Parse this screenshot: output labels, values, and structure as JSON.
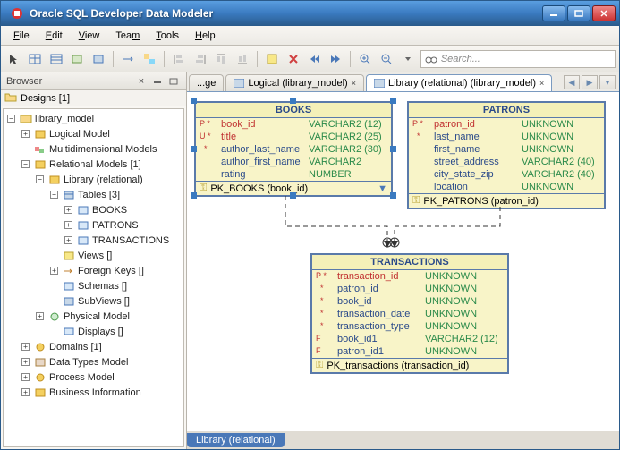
{
  "title": "Oracle SQL Developer Data Modeler",
  "menubar": {
    "file": "File",
    "edit": "Edit",
    "view": "View",
    "team": "Team",
    "tools": "Tools",
    "help": "Help"
  },
  "search_placeholder": "Search...",
  "browser": {
    "title": "Browser",
    "designs_label": "Designs [1]",
    "root": "library_model",
    "logical": "Logical Model",
    "multi": "Multidimensional Models",
    "relational": "Relational Models [1]",
    "library": "Library (relational)",
    "tables": "Tables [3]",
    "t1": "BOOKS",
    "t2": "PATRONS",
    "t3": "TRANSACTIONS",
    "views": "Views []",
    "fkeys": "Foreign Keys []",
    "schemas": "Schemas []",
    "subviews": "SubViews []",
    "physical": "Physical Model",
    "displays": "Displays []",
    "domains": "Domains [1]",
    "datatypes": "Data Types Model",
    "process": "Process Model",
    "business": "Business Information"
  },
  "tabs": {
    "t1": "...ge",
    "t2": "Logical (library_model)",
    "t3": "Library (relational) (library_model)"
  },
  "entities": {
    "books": {
      "title": "BOOKS",
      "pk": "PK_BOOKS (book_id)",
      "rows": [
        {
          "flag": "P *",
          "name": "book_id",
          "type": "VARCHAR2 (12)"
        },
        {
          "flag": "U *",
          "name": "title",
          "type": "VARCHAR2 (25)"
        },
        {
          "flag": "  *",
          "name": "author_last_name",
          "type": "VARCHAR2 (30)",
          "norm": true
        },
        {
          "flag": "",
          "name": "author_first_name",
          "type": "VARCHAR2",
          "norm": true
        },
        {
          "flag": "",
          "name": "rating",
          "type": "NUMBER",
          "norm": true
        }
      ]
    },
    "patrons": {
      "title": "PATRONS",
      "pk": "PK_PATRONS (patron_id)",
      "rows": [
        {
          "flag": "P *",
          "name": "patron_id",
          "type": "UNKNOWN"
        },
        {
          "flag": "  *",
          "name": "last_name",
          "type": "UNKNOWN",
          "norm": true
        },
        {
          "flag": "",
          "name": "first_name",
          "type": "UNKNOWN",
          "norm": true
        },
        {
          "flag": "",
          "name": "street_address",
          "type": "VARCHAR2 (40)",
          "norm": true
        },
        {
          "flag": "",
          "name": "city_state_zip",
          "type": "VARCHAR2 (40)",
          "norm": true
        },
        {
          "flag": "",
          "name": "location",
          "type": "UNKNOWN",
          "norm": true
        }
      ]
    },
    "trans": {
      "title": "TRANSACTIONS",
      "pk": "PK_transactions (transaction_id)",
      "rows": [
        {
          "flag": "P *",
          "name": "transaction_id",
          "type": "UNKNOWN"
        },
        {
          "flag": "  *",
          "name": "patron_id",
          "type": "UNKNOWN",
          "norm": true
        },
        {
          "flag": "  *",
          "name": "book_id",
          "type": "UNKNOWN",
          "norm": true
        },
        {
          "flag": "  *",
          "name": "transaction_date",
          "type": "UNKNOWN",
          "norm": true
        },
        {
          "flag": "  *",
          "name": "transaction_type",
          "type": "UNKNOWN",
          "norm": true
        },
        {
          "flag": "F",
          "name": "book_id1",
          "type": "VARCHAR2 (12)",
          "norm": true
        },
        {
          "flag": "F",
          "name": "patron_id1",
          "type": "UNKNOWN",
          "norm": true
        }
      ]
    }
  },
  "footer_tab": "Library (relational)"
}
